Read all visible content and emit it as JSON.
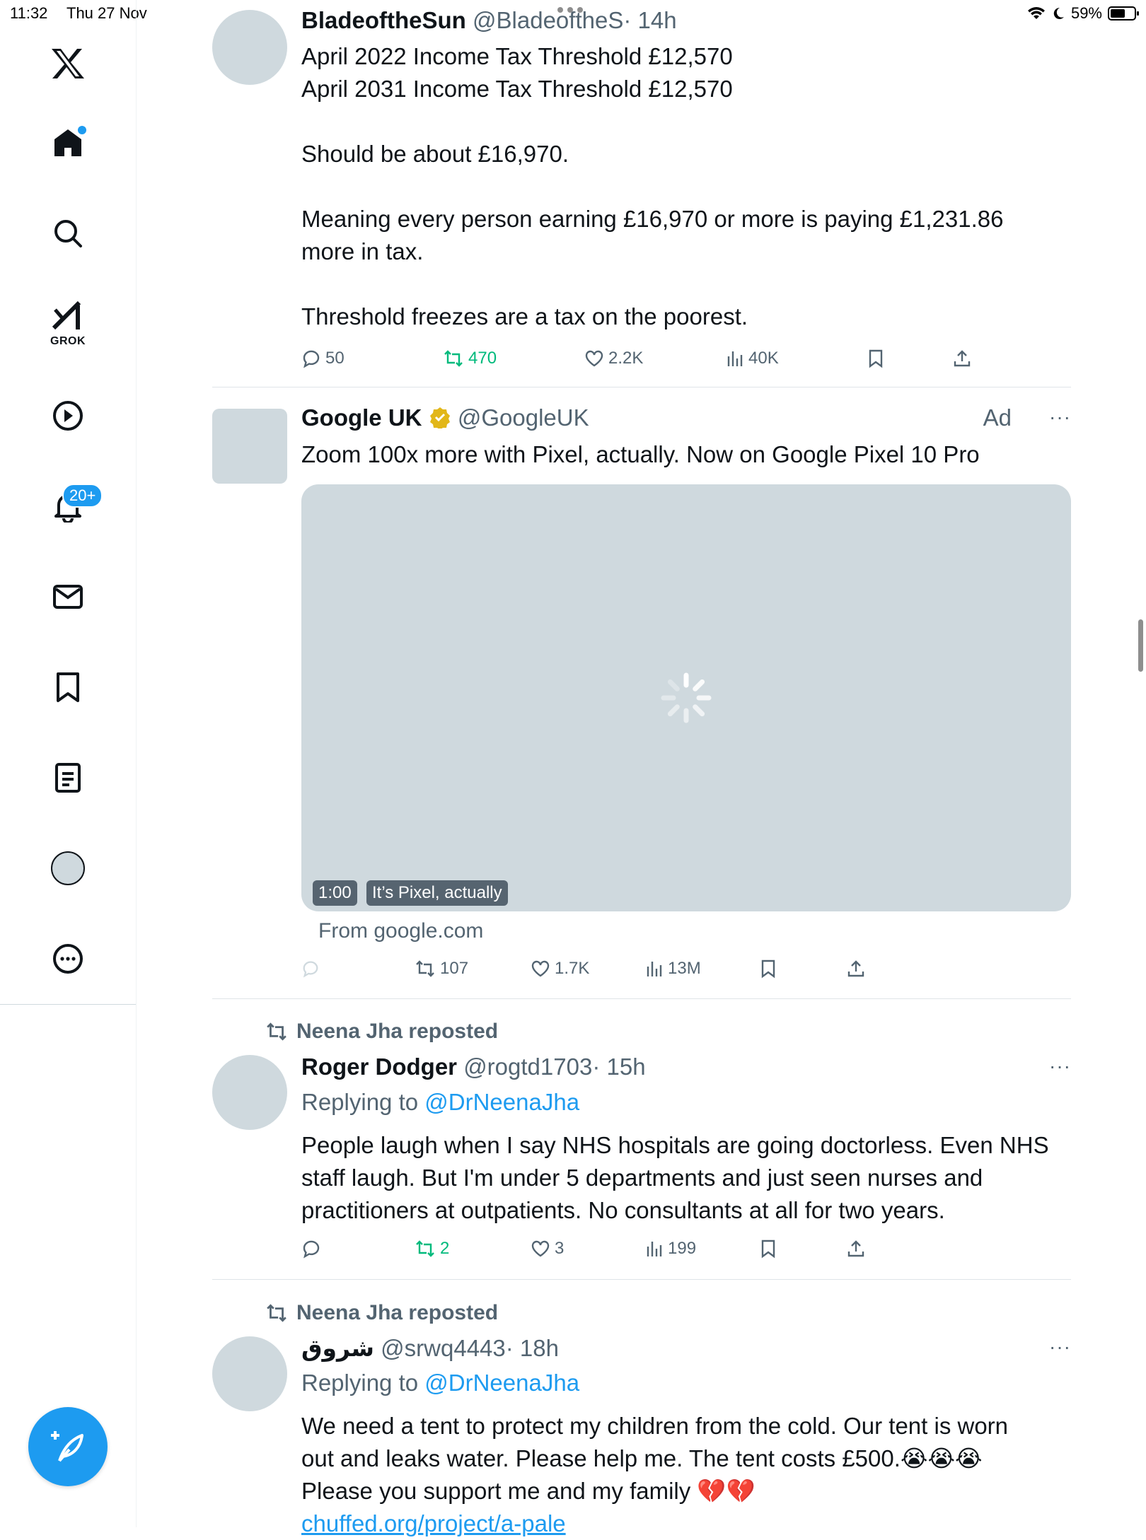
{
  "status_bar": {
    "time": "11:32",
    "date": "Thu 27 Nov",
    "battery": "59%"
  },
  "sidebar": {
    "grok_label": "GROK",
    "notifications_count": "20+",
    "accent": "#1d9bf0"
  },
  "posts": [
    {
      "name": "BladeoftheSun",
      "handle": "@BladeoftheS",
      "time": "· 14h",
      "text": "April 2022 Income Tax Threshold £12,570\nApril 2031 Income Tax Threshold £12,570\n\nShould be about £16,970.\n\nMeaning every person earning £16,970 or more is paying £1,231.86\nmore in tax.\n\nThreshold freezes are a tax on the poorest.",
      "replies": "50",
      "reposts": "470",
      "likes": "2.2K",
      "views": "40K"
    },
    {
      "name": "Google UK",
      "handle": "@GoogleUK",
      "ad_label": "Ad",
      "more": "···",
      "text": "Zoom 100x more with Pixel, actually. Now on Google Pixel 10 Pro",
      "video_duration": "1:00",
      "video_caption": "It’s Pixel, actually",
      "source": "From google.com",
      "reposts": "107",
      "likes": "1.7K",
      "views": "13M"
    },
    {
      "reposted_by": "Neena Jha reposted",
      "name": "Roger Dodger",
      "handle": "@rogtd1703",
      "time": "· 15h",
      "more": "···",
      "replying_prefix": "Replying to",
      "replying_to": "@DrNeenaJha",
      "text": "People laugh when I say NHS hospitals are going doctorless. Even NHS\nstaff laugh. But I'm under 5 departments and just seen nurses and\npractitioners at outpatients. No consultants at all for two years.",
      "reposts": "2",
      "likes": "3",
      "views": "199"
    },
    {
      "reposted_by": "Neena Jha reposted",
      "name": "شروق",
      "handle": "@srwq4443",
      "time": "· 18h",
      "more": "···",
      "replying_prefix": "Replying to",
      "replying_to": "@DrNeenaJha",
      "text": "We need a tent to protect my children from the cold. Our tent is worn\nout and leaks water. Please help me. The tent costs £500.😭😭😭\nPlease you support me and my family 💔💔",
      "link": "chuffed.org/project/a-pale"
    }
  ]
}
